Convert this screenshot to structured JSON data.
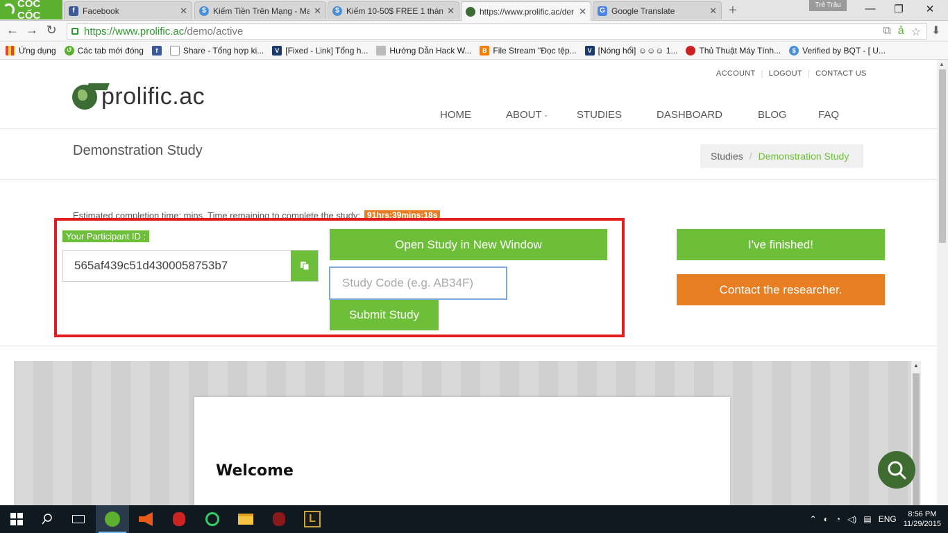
{
  "browser": {
    "brand": "CỐC CỐC",
    "profile": "Trẻ Trâu",
    "tabs": [
      {
        "title": "Facebook",
        "fav_color": "#3b5998",
        "fav_glyph": "f",
        "active": false
      },
      {
        "title": "Kiếm Tiền Trên Mạng - Ma",
        "fav_color": "#4a90d9",
        "fav_glyph": "S",
        "active": false
      },
      {
        "title": "Kiếm 10-50$ FREE 1 tháng",
        "fav_color": "#4a90d9",
        "fav_glyph": "S",
        "active": false
      },
      {
        "title": "https://www.prolific.ac/der",
        "fav_color": "#3c6b35",
        "fav_glyph": "",
        "active": true
      },
      {
        "title": "Google Translate",
        "fav_color": "#4a86e8",
        "fav_glyph": "G",
        "active": false
      }
    ],
    "url_host": "https://www.prolific.ac",
    "url_path": "/demo/active",
    "bookmarks": [
      {
        "label": "Ứng dụng",
        "color": "#d44"
      },
      {
        "label": "Các tab mới đóng",
        "color": "#5cb030"
      },
      {
        "label": "",
        "color": "#3b5998"
      },
      {
        "label": "Share - Tổng hợp ki...",
        "color": "#999"
      },
      {
        "label": "[Fixed - Link] Tổng h...",
        "color": "#1a3a6a"
      },
      {
        "label": "Hướng Dẫn Hack W...",
        "color": "#777"
      },
      {
        "label": "File Stream \"Đọc tệp...",
        "color": "#f57d00"
      },
      {
        "label": "[Nóng hổi] ☺☺☺ 1...",
        "color": "#1a3a6a"
      },
      {
        "label": "Thủ Thuật Máy Tính...",
        "color": "#c22"
      },
      {
        "label": "Verified by BQT - [ U...",
        "color": "#4a90d9"
      }
    ]
  },
  "site": {
    "top_links": [
      "ACCOUNT",
      "LOGOUT",
      "CONTACT US"
    ],
    "logo_text": "prolific.ac",
    "nav": [
      "HOME",
      "ABOUT",
      "STUDIES",
      "DASHBOARD",
      "BLOG",
      "FAQ"
    ],
    "page_title": "Demonstration Study",
    "breadcrumb": {
      "root": "Studies",
      "current": "Demonstration Study"
    }
  },
  "study": {
    "estimate_text": "Estimated completion time: mins. Time remaining to complete the study:",
    "timer": "91hrs:39mins:18s",
    "participant_label": "Your Participant ID :",
    "participant_id": "565af439c51d4300058753b7",
    "open_button": "Open Study in New Window",
    "code_placeholder": "Study Code (e.g. AB34F)",
    "submit_button": "Submit Study",
    "finished_button": "I've finished!",
    "contact_button": "Contact the researcher."
  },
  "embedded": {
    "heading": "Welcome"
  },
  "taskbar": {
    "language": "ENG",
    "time": "8:56 PM",
    "date": "11/29/2015"
  },
  "colors": {
    "green": "#6dbf3a",
    "orange": "#e87e22",
    "highlight": "#e02020"
  }
}
